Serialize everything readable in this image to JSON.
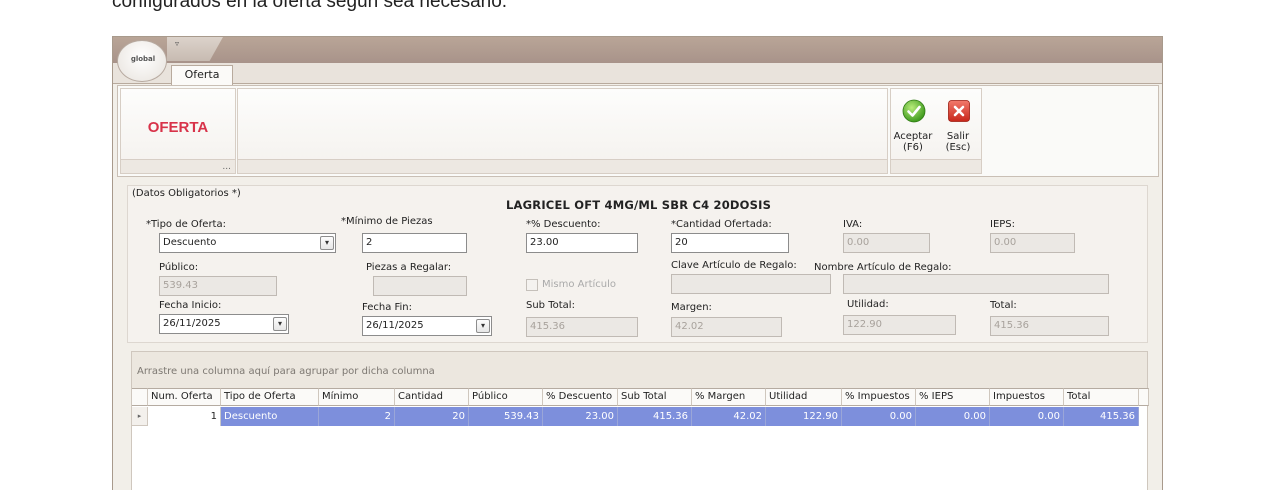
{
  "doc_text": "configurados en la oferta según sea necesario.",
  "app": {
    "logo_text": "global",
    "quick_access_arrow": "▿"
  },
  "tab": {
    "label": "Oferta"
  },
  "ribbon": {
    "group_title": "OFERTA",
    "group_more": "...",
    "accept": {
      "line1": "Aceptar",
      "line2": "(F6)"
    },
    "exit": {
      "line1": "Salir",
      "line2": "(Esc)"
    }
  },
  "form": {
    "required_note": "(Datos Obligatorios *)",
    "product_name": "LAGRICEL OFT 4MG/ML SBR C4 20DOSIS",
    "tipo_oferta": {
      "label": "*Tipo de Oferta:",
      "value": "Descuento"
    },
    "minimo_piezas": {
      "label": "*Mínimo de Piezas",
      "value": "2"
    },
    "descuento": {
      "label": "*% Descuento:",
      "value": "23.00"
    },
    "cantidad_ofertada": {
      "label": "*Cantidad Ofertada:",
      "value": "20"
    },
    "iva": {
      "label": "IVA:",
      "value": "0.00"
    },
    "ieps": {
      "label": "IEPS:",
      "value": "0.00"
    },
    "publico": {
      "label": "Público:",
      "value": "539.43"
    },
    "piezas_regalar": {
      "label": "Piezas a Regalar:",
      "value": ""
    },
    "mismo_articulo": {
      "label": "Mismo Artículo",
      "checked": false
    },
    "clave_regalo": {
      "label": "Clave Artículo de Regalo:",
      "value": ""
    },
    "nombre_regalo": {
      "label": "Nombre Artículo de Regalo:",
      "value": ""
    },
    "fecha_inicio": {
      "label": "Fecha Inicio:",
      "value": "26/11/2025"
    },
    "fecha_fin": {
      "label": "Fecha Fin:",
      "value": "26/11/2025"
    },
    "sub_total": {
      "label": "Sub Total:",
      "value": "415.36"
    },
    "margen": {
      "label": "Margen:",
      "value": "42.02"
    },
    "utilidad": {
      "label": "Utilidad:",
      "value": "122.90"
    },
    "total": {
      "label": "Total:",
      "value": "415.36"
    }
  },
  "grid": {
    "group_hint": "Arrastre una columna aquí para agrupar por dicha columna",
    "columns": [
      "Num. Oferta",
      "Tipo de Oferta",
      "Mínimo",
      "Cantidad",
      "Público",
      "% Descuento",
      "Sub Total",
      "% Margen",
      "Utilidad",
      "% Impuestos",
      "% IEPS",
      "Impuestos",
      "Total"
    ],
    "rows": [
      [
        "1",
        "Descuento",
        "2",
        "20",
        "539.43",
        "23.00",
        "415.36",
        "42.02",
        "122.90",
        "0.00",
        "0.00",
        "0.00",
        "415.36"
      ]
    ],
    "row_indicator": "▸",
    "colors": {
      "selected_row": "#7d8fdc"
    }
  }
}
